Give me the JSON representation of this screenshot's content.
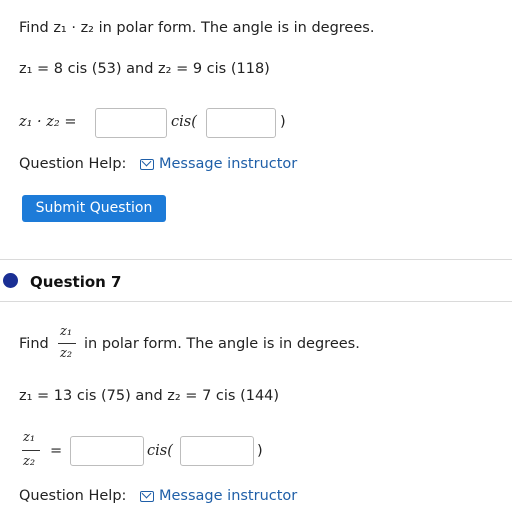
{
  "colors": {
    "accent": "#1d7bd8",
    "link": "#1f5fa8",
    "question_dot": "#1a2f94"
  },
  "q6": {
    "prompt": "Find z₁ · z₂ in polar form. The angle is in degrees.",
    "given": "z₁ = 8 cis (53) and z₂ = 9 cis (118)",
    "answer_label": "z₁ · z₂ =",
    "cis": "cis(",
    "close_paren": ")",
    "modulus_value": "",
    "angle_value": "",
    "help_label": "Question Help:",
    "help_link": "Message instructor",
    "submit_label": "Submit Question"
  },
  "q7": {
    "title": "Question 7",
    "find": "Find",
    "frac_num": "z₁",
    "frac_den": "z₂",
    "prompt_rest": "in polar form. The angle is in degrees.",
    "given": "z₁ = 13 cis (75) and z₂ = 7 cis (144)",
    "equals": "=",
    "cis": "cis(",
    "close_paren": ")",
    "modulus_value": "",
    "angle_value": "",
    "help_label": "Question Help:",
    "help_link": "Message instructor"
  }
}
